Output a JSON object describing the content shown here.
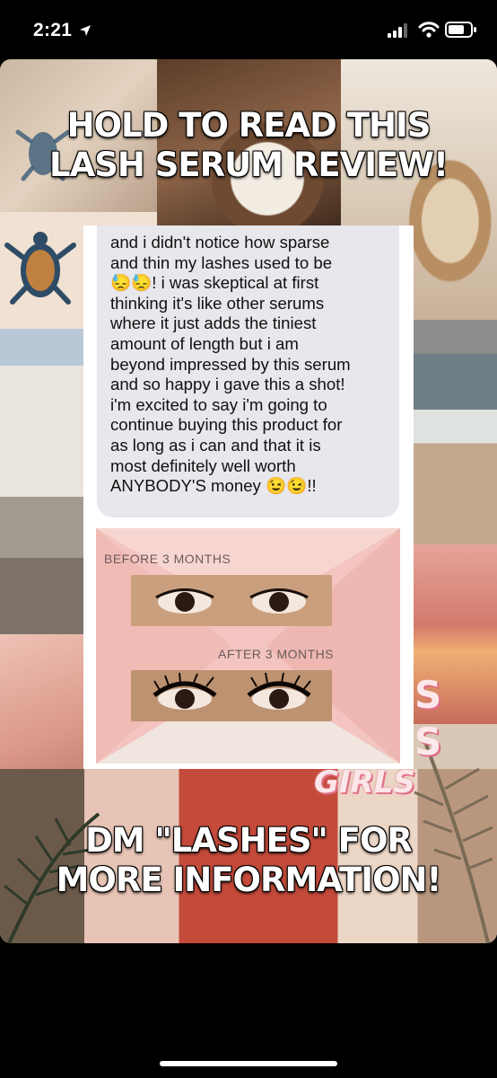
{
  "status_bar": {
    "time": "2:21",
    "icons": [
      "location-arrow-icon",
      "cellular-signal-icon",
      "wifi-icon",
      "battery-icon"
    ]
  },
  "story": {
    "headline_top": "HOLD TO READ THIS\nLASH SERUM REVIEW!",
    "headline_bottom": "DM \"LASHES\" FOR\nMORE INFORMATION!",
    "background_word": "GIRLS",
    "review_text": "and i didn't notice how sparse\nand thin my lashes used to be\n😓😓! i was skeptical at first\nthinking it's like other serums\nwhere it just adds the tiniest\namount of length but i am\nbeyond impressed by this serum\nand so happy i gave this a shot!\ni'm excited to say i'm going to\ncontinue buying this product for\nas long as i can and that it is\nmost definitely well worth\nANYBODY'S money 😉😉!!",
    "before_label": "BEFORE 3 MONTHS",
    "after_label": "AFTER 3 MONTHS"
  },
  "colors": {
    "background": "#000000",
    "bubble": "#e7e7ec",
    "card_pink": "#f3c4c0",
    "accent_pink": "#e06b84"
  }
}
